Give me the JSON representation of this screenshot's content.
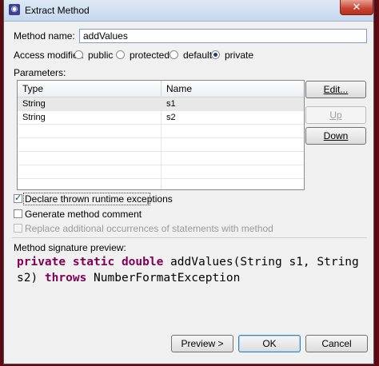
{
  "window": {
    "title": "Extract Method",
    "close_glyph": "✕"
  },
  "method_name": {
    "label": "Method name:",
    "value": "addValues"
  },
  "access_modifier": {
    "label": "Access modifier:",
    "options": [
      "public",
      "protected",
      "default",
      "private"
    ],
    "selected": "private"
  },
  "parameters": {
    "label": "Parameters:",
    "columns": [
      "Type",
      "Name"
    ],
    "rows": [
      {
        "type": "String",
        "name": "s1"
      },
      {
        "type": "String",
        "name": "s2"
      }
    ]
  },
  "buttons": {
    "edit": "Edit...",
    "up": "Up",
    "down": "Down",
    "preview": "Preview >",
    "ok": "OK",
    "cancel": "Cancel"
  },
  "options": {
    "declare_exceptions": {
      "label": "Declare thrown runtime exceptions",
      "checked": true
    },
    "generate_comment": {
      "label": "Generate method comment",
      "checked": false
    },
    "replace_occurrences": {
      "label": "Replace additional occurrences of statements with method",
      "checked": false,
      "enabled": false
    }
  },
  "signature_preview": {
    "label": "Method signature preview:",
    "kw1": "private static double",
    "line1_rest": " addValues(String s1, String",
    "line2_start": "s2) ",
    "kw2": "throws",
    "line2_rest": " NumberFormatException"
  }
}
